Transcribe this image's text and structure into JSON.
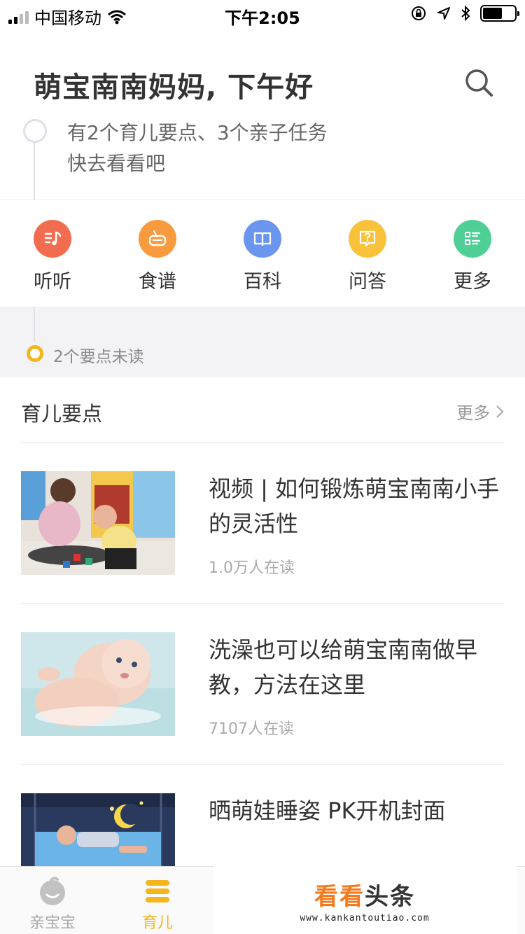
{
  "status_bar": {
    "carrier": "中国移动",
    "time": "下午2:05"
  },
  "header": {
    "greeting": "萌宝南南妈妈, 下午好",
    "tip_line1": "有2个育儿要点、3个亲子任务",
    "tip_line2": "快去看看吧"
  },
  "quick_entries": [
    {
      "label": "听听",
      "icon": "music-icon",
      "color": "#f26d4f"
    },
    {
      "label": "食谱",
      "icon": "bowl-icon",
      "color": "#f89b3f"
    },
    {
      "label": "百科",
      "icon": "book-icon",
      "color": "#6b96f0"
    },
    {
      "label": "问答",
      "icon": "question-icon",
      "color": "#f8c23a"
    },
    {
      "label": "更多",
      "icon": "list-icon",
      "color": "#4fcf96"
    }
  ],
  "unread": "2个要点未读",
  "section": {
    "title": "育儿要点",
    "more": "更多"
  },
  "articles": [
    {
      "title": "视频 | 如何锻炼萌宝南南小手的灵活性",
      "readers": "1.0万人在读"
    },
    {
      "title": "洗澡也可以给萌宝南南做早教，方法在这里",
      "readers": "7107人在读"
    },
    {
      "title": "晒萌娃睡姿 PK开机封面",
      "readers": ""
    }
  ],
  "tab_bar": {
    "tabs": [
      {
        "label": "亲宝宝",
        "active": false
      },
      {
        "label": "育儿",
        "active": true
      }
    ],
    "active_color": "#f5b51c",
    "inactive_color": "#aaaaaa"
  },
  "watermark": {
    "logo_part1": "看看",
    "logo_part2": "头条",
    "url": "www.kankantoutiao.com"
  }
}
